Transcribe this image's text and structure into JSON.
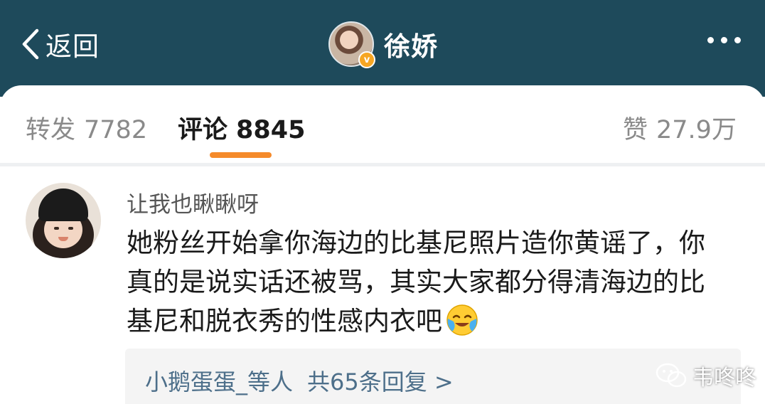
{
  "header": {
    "back_label": "返回",
    "profile_name": "徐娇",
    "verified_badge": "v"
  },
  "tabs": [
    {
      "label": "转发",
      "count": "7782"
    },
    {
      "label": "评论",
      "count": "8845",
      "active": true
    },
    {
      "label": "赞",
      "count": "27.9万"
    }
  ],
  "comment": {
    "username": "让我也瞅瞅呀",
    "lines": [
      "她粉丝开始拿你海边的比基尼照片造你黄谣了，你",
      "真的是说实话还被骂，其实大家都分得清海边的比",
      "基尼和脱衣秀的性感内衣吧"
    ],
    "emoji": "crying-laughing-emoji"
  },
  "replies": {
    "who": "小鹅蛋蛋_等人",
    "count_text": "共65条回复 >"
  },
  "watermark": {
    "text": "韦咚咚"
  },
  "colors": {
    "header_bg": "#1e4a5b",
    "accent_underline": "#f58a2a",
    "link_blue": "#4d6f8a"
  }
}
